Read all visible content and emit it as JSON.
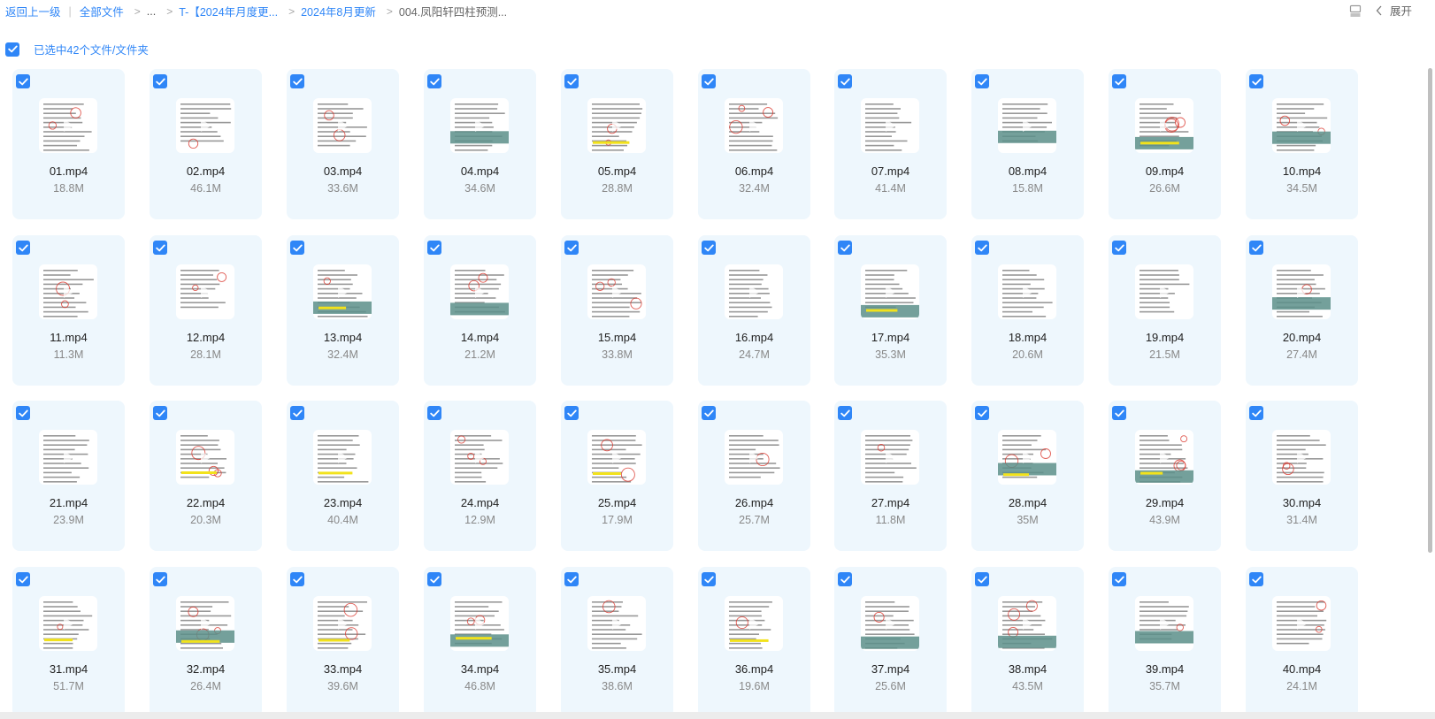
{
  "breadcrumb": {
    "back_label": "返回上一级",
    "all_files_label": "全部文件",
    "ellipsis_label": "...",
    "items": [
      "T-【2024年月度更...",
      "2024年8月更新",
      "004.凤阳轩四柱预测..."
    ]
  },
  "toolbar": {
    "expand_label": "展开"
  },
  "selection": {
    "label": "已选中42个文件/文件夹"
  },
  "files": [
    {
      "name": "01.mp4",
      "size": "18.8M"
    },
    {
      "name": "02.mp4",
      "size": "46.1M"
    },
    {
      "name": "03.mp4",
      "size": "33.6M"
    },
    {
      "name": "04.mp4",
      "size": "34.6M"
    },
    {
      "name": "05.mp4",
      "size": "28.8M"
    },
    {
      "name": "06.mp4",
      "size": "32.4M"
    },
    {
      "name": "07.mp4",
      "size": "41.4M"
    },
    {
      "name": "08.mp4",
      "size": "15.8M"
    },
    {
      "name": "09.mp4",
      "size": "26.6M"
    },
    {
      "name": "10.mp4",
      "size": "34.5M"
    },
    {
      "name": "11.mp4",
      "size": "11.3M"
    },
    {
      "name": "12.mp4",
      "size": "28.1M"
    },
    {
      "name": "13.mp4",
      "size": "32.4M"
    },
    {
      "name": "14.mp4",
      "size": "21.2M"
    },
    {
      "name": "15.mp4",
      "size": "33.8M"
    },
    {
      "name": "16.mp4",
      "size": "24.7M"
    },
    {
      "name": "17.mp4",
      "size": "35.3M"
    },
    {
      "name": "18.mp4",
      "size": "20.6M"
    },
    {
      "name": "19.mp4",
      "size": "21.5M"
    },
    {
      "name": "20.mp4",
      "size": "27.4M"
    },
    {
      "name": "21.mp4",
      "size": "23.9M"
    },
    {
      "name": "22.mp4",
      "size": "20.3M"
    },
    {
      "name": "23.mp4",
      "size": "40.4M"
    },
    {
      "name": "24.mp4",
      "size": "12.9M"
    },
    {
      "name": "25.mp4",
      "size": "17.9M"
    },
    {
      "name": "26.mp4",
      "size": "25.7M"
    },
    {
      "name": "27.mp4",
      "size": "11.8M"
    },
    {
      "name": "28.mp4",
      "size": "35M"
    },
    {
      "name": "29.mp4",
      "size": "43.9M"
    },
    {
      "name": "30.mp4",
      "size": "31.4M"
    },
    {
      "name": "31.mp4",
      "size": "51.7M"
    },
    {
      "name": "32.mp4",
      "size": "26.4M"
    },
    {
      "name": "33.mp4",
      "size": "39.6M"
    },
    {
      "name": "34.mp4",
      "size": "46.8M"
    },
    {
      "name": "35.mp4",
      "size": "38.6M"
    },
    {
      "name": "36.mp4",
      "size": "19.6M"
    },
    {
      "name": "37.mp4",
      "size": "25.6M"
    },
    {
      "name": "38.mp4",
      "size": "43.5M"
    },
    {
      "name": "39.mp4",
      "size": "35.7M"
    },
    {
      "name": "40.mp4",
      "size": "24.1M"
    }
  ],
  "colors": {
    "accent": "#2f86f7",
    "card_bg": "#eef7fd"
  }
}
